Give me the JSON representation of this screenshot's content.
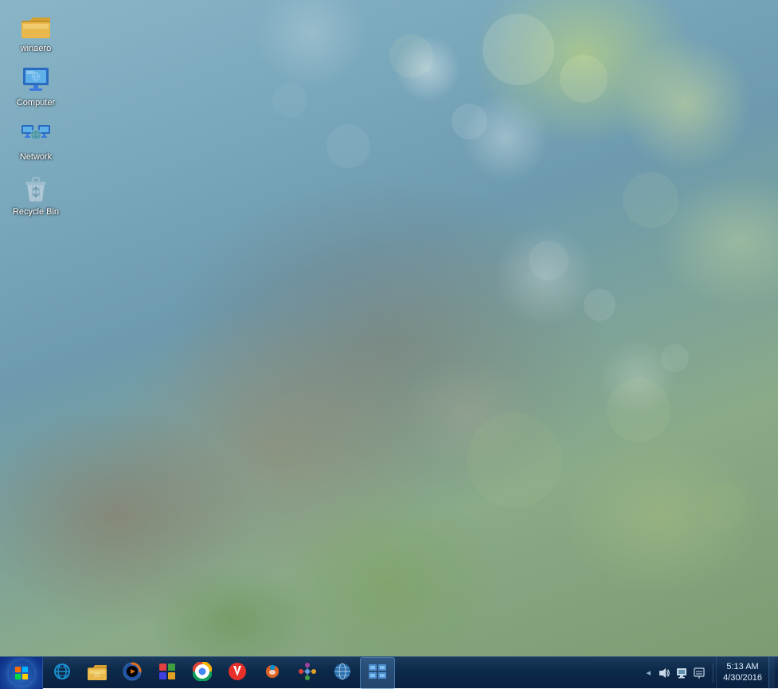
{
  "desktop": {
    "icons": [
      {
        "id": "winaero",
        "label": "winaero",
        "icon_type": "folder",
        "icon_color": "#e8b84a"
      },
      {
        "id": "computer",
        "label": "Computer",
        "icon_type": "computer",
        "icon_color": "#4a90d0"
      },
      {
        "id": "network",
        "label": "Network",
        "icon_type": "network",
        "icon_color": "#4a90d0"
      },
      {
        "id": "recycle-bin",
        "label": "Recycle Bin",
        "icon_type": "recycle",
        "icon_color": "#aaccdd"
      }
    ]
  },
  "taskbar": {
    "start_label": "",
    "pinned_icons": [
      {
        "id": "ie",
        "label": "Internet Explorer",
        "icon": "🌐"
      },
      {
        "id": "explorer",
        "label": "Windows Explorer",
        "icon": "📁"
      },
      {
        "id": "media-player",
        "label": "Windows Media Player",
        "icon": "▶"
      },
      {
        "id": "paint",
        "label": "Paint",
        "icon": "🎨"
      },
      {
        "id": "chrome",
        "label": "Google Chrome",
        "icon": "◉"
      },
      {
        "id": "vivaldi",
        "label": "Vivaldi",
        "icon": "❤"
      },
      {
        "id": "firefox",
        "label": "Firefox",
        "icon": "🦊"
      },
      {
        "id": "app7",
        "label": "App",
        "icon": "⚙"
      },
      {
        "id": "globe",
        "label": "Globe",
        "icon": "🌍"
      },
      {
        "id": "network-tray",
        "label": "Network Display",
        "icon": "🖥"
      }
    ],
    "tray": {
      "chevron": "◂",
      "icons": [
        {
          "id": "volume",
          "label": "Volume",
          "icon": "🔊"
        },
        {
          "id": "network-status",
          "label": "Network",
          "icon": "📶"
        },
        {
          "id": "action-center",
          "label": "Action Center",
          "icon": "⚑"
        }
      ],
      "clock_time": "5:13 AM",
      "clock_date": "4/30/2016"
    }
  }
}
